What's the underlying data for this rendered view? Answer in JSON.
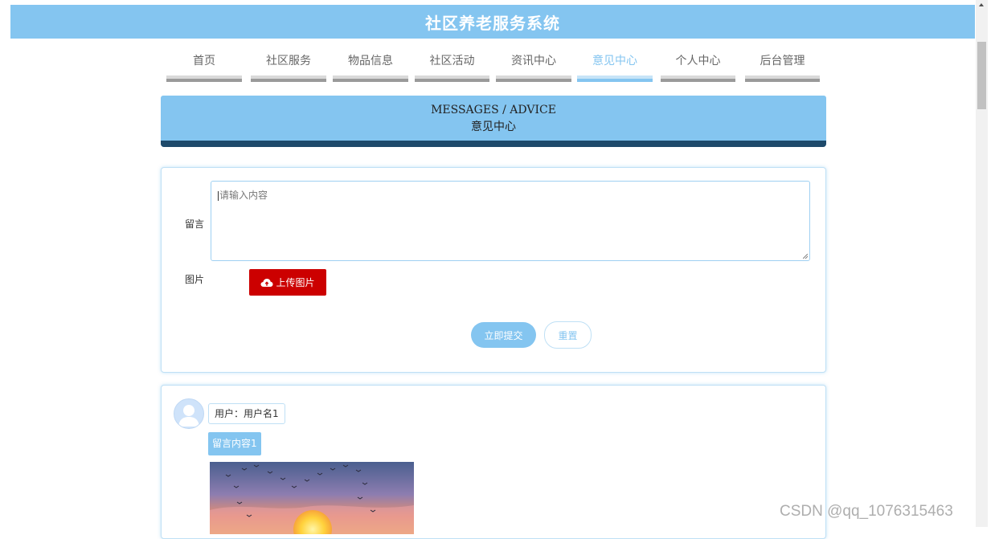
{
  "header": {
    "title": "社区养老服务系统"
  },
  "nav": {
    "items": [
      {
        "label": "首页",
        "active": false
      },
      {
        "label": "社区服务",
        "active": false
      },
      {
        "label": "物品信息",
        "active": false
      },
      {
        "label": "社区活动",
        "active": false
      },
      {
        "label": "资讯中心",
        "active": false
      },
      {
        "label": "意见中心",
        "active": true
      },
      {
        "label": "个人中心",
        "active": false
      },
      {
        "label": "后台管理",
        "active": false
      }
    ]
  },
  "banner": {
    "title_en": "MESSAGES / ADVICE",
    "title_cn": "意见中心"
  },
  "form": {
    "message_label": "留言",
    "message_placeholder": "请输入内容",
    "image_label": "图片",
    "upload_label": "上传图片",
    "submit_label": "立即提交",
    "reset_label": "重置"
  },
  "messages": [
    {
      "user": "用户：用户名1",
      "content": "留言内容1"
    }
  ],
  "watermark": "CSDN @qq_1076315463",
  "colors": {
    "primary": "#84c5f0",
    "banner_strip": "#1e4a6b",
    "upload": "#cc0000"
  }
}
